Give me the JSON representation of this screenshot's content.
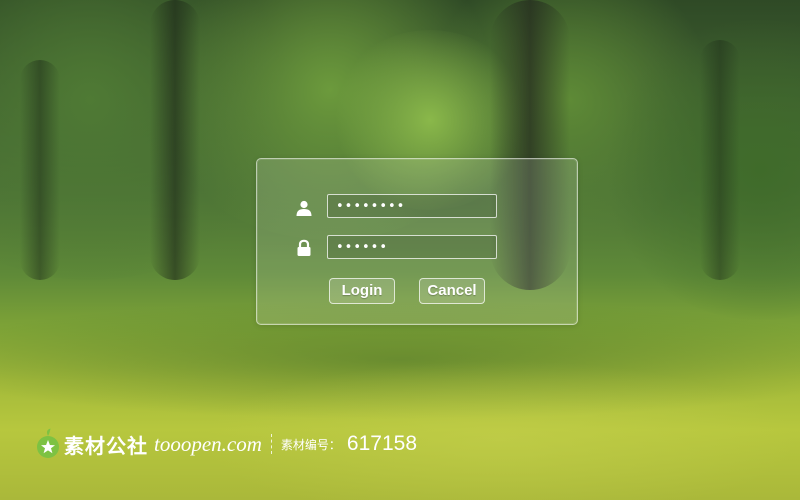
{
  "login_form": {
    "username_value": "••••••••",
    "password_value": "••••••",
    "login_label": "Login",
    "cancel_label": "Cancel"
  },
  "icons": {
    "username": "user-icon",
    "password": "lock-icon",
    "watermark_logo": "leaf-star-logo"
  },
  "watermark": {
    "brand": "素材公社",
    "site": "tooopen.com",
    "id_label": "素材编号：",
    "id_value": "617158"
  },
  "colors": {
    "text": "#ffffff",
    "logo_green": "#7dc242"
  }
}
